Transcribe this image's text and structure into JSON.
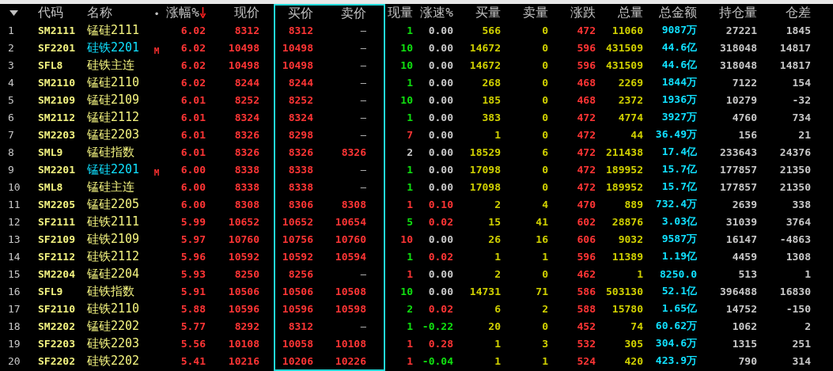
{
  "columns": [
    {
      "label": "代码"
    },
    {
      "label": "名称"
    },
    {
      "label": "•"
    },
    {
      "label": "涨幅%",
      "sorted": true
    },
    {
      "label": "现价"
    },
    {
      "label": "买价"
    },
    {
      "label": "卖价"
    },
    {
      "label": "现量"
    },
    {
      "label": "涨速%"
    },
    {
      "label": "买量"
    },
    {
      "label": "卖量"
    },
    {
      "label": "涨跌"
    },
    {
      "label": "总量"
    },
    {
      "label": "总金额"
    },
    {
      "label": "持仓量"
    },
    {
      "label": "仓差"
    }
  ],
  "rows": [
    {
      "num": "1",
      "code": "SM2111",
      "name": "锰硅2111",
      "main": false,
      "change_pct": "6.02",
      "price": "8312",
      "bid": "8312",
      "ask": "—",
      "ask_empty": true,
      "last_vol": {
        "text": "1",
        "color": "#10e010"
      },
      "speed": {
        "text": "0.00",
        "color": "#c8c8c8"
      },
      "bid_vol": "566",
      "ask_vol": "0",
      "change": "472",
      "volume": "11060",
      "amount": "9087万",
      "open_int": "27221",
      "oi_change": "1845"
    },
    {
      "num": "2",
      "code": "SF2201",
      "name": "硅铁2201",
      "main": true,
      "flag": "M",
      "change_pct": "6.02",
      "price": "10498",
      "bid": "10498",
      "ask": "—",
      "ask_empty": true,
      "last_vol": {
        "text": "10",
        "color": "#10e010"
      },
      "speed": {
        "text": "0.00",
        "color": "#c8c8c8"
      },
      "bid_vol": "14672",
      "ask_vol": "0",
      "change": "596",
      "volume": "431509",
      "amount": "44.6亿",
      "open_int": "318048",
      "oi_change": "14817"
    },
    {
      "num": "3",
      "code": "SFL8",
      "name": "硅铁主连",
      "main": false,
      "change_pct": "6.02",
      "price": "10498",
      "bid": "10498",
      "ask": "—",
      "ask_empty": true,
      "last_vol": {
        "text": "10",
        "color": "#10e010"
      },
      "speed": {
        "text": "0.00",
        "color": "#c8c8c8"
      },
      "bid_vol": "14672",
      "ask_vol": "0",
      "change": "596",
      "volume": "431509",
      "amount": "44.6亿",
      "open_int": "318048",
      "oi_change": "14817"
    },
    {
      "num": "4",
      "code": "SM2110",
      "name": "锰硅2110",
      "main": false,
      "change_pct": "6.02",
      "price": "8244",
      "bid": "8244",
      "ask": "—",
      "ask_empty": true,
      "last_vol": {
        "text": "1",
        "color": "#10e010"
      },
      "speed": {
        "text": "0.00",
        "color": "#c8c8c8"
      },
      "bid_vol": "268",
      "ask_vol": "0",
      "change": "468",
      "volume": "2269",
      "amount": "1844万",
      "open_int": "7122",
      "oi_change": "154"
    },
    {
      "num": "5",
      "code": "SM2109",
      "name": "锰硅2109",
      "main": false,
      "change_pct": "6.01",
      "price": "8252",
      "bid": "8252",
      "ask": "—",
      "ask_empty": true,
      "last_vol": {
        "text": "10",
        "color": "#10e010"
      },
      "speed": {
        "text": "0.00",
        "color": "#c8c8c8"
      },
      "bid_vol": "185",
      "ask_vol": "0",
      "change": "468",
      "volume": "2372",
      "amount": "1936万",
      "open_int": "10279",
      "oi_change": "-32"
    },
    {
      "num": "6",
      "code": "SM2112",
      "name": "锰硅2112",
      "main": false,
      "change_pct": "6.01",
      "price": "8324",
      "bid": "8324",
      "ask": "—",
      "ask_empty": true,
      "last_vol": {
        "text": "1",
        "color": "#10e010"
      },
      "speed": {
        "text": "0.00",
        "color": "#c8c8c8"
      },
      "bid_vol": "383",
      "ask_vol": "0",
      "change": "472",
      "volume": "4774",
      "amount": "3927万",
      "open_int": "4760",
      "oi_change": "734"
    },
    {
      "num": "7",
      "code": "SM2203",
      "name": "锰硅2203",
      "main": false,
      "change_pct": "6.01",
      "price": "8326",
      "bid": "8298",
      "ask": "—",
      "ask_empty": true,
      "last_vol": {
        "text": "7",
        "color": "#ff3535"
      },
      "speed": {
        "text": "0.00",
        "color": "#c8c8c8"
      },
      "bid_vol": "1",
      "ask_vol": "0",
      "change": "472",
      "volume": "44",
      "amount": "36.49万",
      "open_int": "156",
      "oi_change": "21"
    },
    {
      "num": "8",
      "code": "SML9",
      "name": "锰硅指数",
      "main": false,
      "change_pct": "6.01",
      "price": "8326",
      "bid": "8326",
      "ask": "8326",
      "ask_empty": false,
      "last_vol": {
        "text": "2",
        "color": "#c8c8c8"
      },
      "speed": {
        "text": "0.00",
        "color": "#c8c8c8"
      },
      "bid_vol": "18529",
      "ask_vol": "6",
      "change": "472",
      "volume": "211438",
      "amount": "17.4亿",
      "open_int": "233643",
      "oi_change": "24376"
    },
    {
      "num": "9",
      "code": "SM2201",
      "name": "锰硅2201",
      "main": true,
      "flag": "M",
      "change_pct": "6.00",
      "price": "8338",
      "bid": "8338",
      "ask": "—",
      "ask_empty": true,
      "last_vol": {
        "text": "1",
        "color": "#10e010"
      },
      "speed": {
        "text": "0.00",
        "color": "#c8c8c8"
      },
      "bid_vol": "17098",
      "ask_vol": "0",
      "change": "472",
      "volume": "189952",
      "amount": "15.7亿",
      "open_int": "177857",
      "oi_change": "21350"
    },
    {
      "num": "10",
      "code": "SML8",
      "name": "锰硅主连",
      "main": false,
      "change_pct": "6.00",
      "price": "8338",
      "bid": "8338",
      "ask": "—",
      "ask_empty": true,
      "last_vol": {
        "text": "1",
        "color": "#10e010"
      },
      "speed": {
        "text": "0.00",
        "color": "#c8c8c8"
      },
      "bid_vol": "17098",
      "ask_vol": "0",
      "change": "472",
      "volume": "189952",
      "amount": "15.7亿",
      "open_int": "177857",
      "oi_change": "21350"
    },
    {
      "num": "11",
      "code": "SM2205",
      "name": "锰硅2205",
      "main": false,
      "change_pct": "6.00",
      "price": "8308",
      "bid": "8306",
      "ask": "8308",
      "ask_empty": false,
      "last_vol": {
        "text": "1",
        "color": "#ff3535"
      },
      "speed": {
        "text": "0.10",
        "color": "#ff3535"
      },
      "bid_vol": "2",
      "ask_vol": "4",
      "change": "470",
      "volume": "889",
      "amount": "732.4万",
      "open_int": "2639",
      "oi_change": "338"
    },
    {
      "num": "12",
      "code": "SF2111",
      "name": "硅铁2111",
      "main": false,
      "change_pct": "5.99",
      "price": "10652",
      "bid": "10652",
      "ask": "10654",
      "ask_empty": false,
      "last_vol": {
        "text": "5",
        "color": "#10e010"
      },
      "speed": {
        "text": "0.02",
        "color": "#ff3535"
      },
      "bid_vol": "15",
      "ask_vol": "41",
      "change": "602",
      "volume": "28876",
      "amount": "3.03亿",
      "open_int": "31039",
      "oi_change": "3764"
    },
    {
      "num": "13",
      "code": "SF2109",
      "name": "硅铁2109",
      "main": false,
      "change_pct": "5.97",
      "price": "10760",
      "bid": "10756",
      "ask": "10760",
      "ask_empty": false,
      "last_vol": {
        "text": "10",
        "color": "#ff3535"
      },
      "speed": {
        "text": "0.00",
        "color": "#c8c8c8"
      },
      "bid_vol": "26",
      "ask_vol": "16",
      "change": "606",
      "volume": "9032",
      "amount": "9587万",
      "open_int": "16147",
      "oi_change": "-4863"
    },
    {
      "num": "14",
      "code": "SF2112",
      "name": "硅铁2112",
      "main": false,
      "change_pct": "5.96",
      "price": "10592",
      "bid": "10592",
      "ask": "10594",
      "ask_empty": false,
      "last_vol": {
        "text": "1",
        "color": "#10e010"
      },
      "speed": {
        "text": "0.02",
        "color": "#ff3535"
      },
      "bid_vol": "1",
      "ask_vol": "1",
      "change": "596",
      "volume": "11389",
      "amount": "1.19亿",
      "open_int": "4459",
      "oi_change": "1308"
    },
    {
      "num": "15",
      "code": "SM2204",
      "name": "锰硅2204",
      "main": false,
      "change_pct": "5.93",
      "price": "8250",
      "bid": "8256",
      "ask": "—",
      "ask_empty": true,
      "last_vol": {
        "text": "1",
        "color": "#ff3535"
      },
      "speed": {
        "text": "0.00",
        "color": "#c8c8c8"
      },
      "bid_vol": "2",
      "ask_vol": "0",
      "change": "462",
      "volume": "1",
      "amount": "8250.0",
      "open_int": "513",
      "oi_change": "1"
    },
    {
      "num": "16",
      "code": "SFL9",
      "name": "硅铁指数",
      "main": false,
      "change_pct": "5.91",
      "price": "10506",
      "bid": "10506",
      "ask": "10508",
      "ask_empty": false,
      "last_vol": {
        "text": "10",
        "color": "#10e010"
      },
      "speed": {
        "text": "0.00",
        "color": "#c8c8c8"
      },
      "bid_vol": "14731",
      "ask_vol": "71",
      "change": "586",
      "volume": "503130",
      "amount": "52.1亿",
      "open_int": "396488",
      "oi_change": "16830"
    },
    {
      "num": "17",
      "code": "SF2110",
      "name": "硅铁2110",
      "main": false,
      "change_pct": "5.88",
      "price": "10596",
      "bid": "10596",
      "ask": "10598",
      "ask_empty": false,
      "last_vol": {
        "text": "2",
        "color": "#10e010"
      },
      "speed": {
        "text": "0.02",
        "color": "#ff3535"
      },
      "bid_vol": "6",
      "ask_vol": "2",
      "change": "588",
      "volume": "15780",
      "amount": "1.65亿",
      "open_int": "14752",
      "oi_change": "-150"
    },
    {
      "num": "18",
      "code": "SM2202",
      "name": "锰硅2202",
      "main": false,
      "change_pct": "5.77",
      "price": "8292",
      "bid": "8312",
      "ask": "—",
      "ask_empty": true,
      "last_vol": {
        "text": "1",
        "color": "#10e010"
      },
      "speed": {
        "text": "-0.22",
        "color": "#10e010"
      },
      "bid_vol": "20",
      "ask_vol": "0",
      "change": "452",
      "volume": "74",
      "amount": "60.62万",
      "open_int": "1062",
      "oi_change": "2"
    },
    {
      "num": "19",
      "code": "SF2203",
      "name": "硅铁2203",
      "main": false,
      "change_pct": "5.56",
      "price": "10108",
      "bid": "10058",
      "ask": "10108",
      "ask_empty": false,
      "last_vol": {
        "text": "1",
        "color": "#ff3535"
      },
      "speed": {
        "text": "0.28",
        "color": "#ff3535"
      },
      "bid_vol": "1",
      "ask_vol": "3",
      "change": "532",
      "volume": "305",
      "amount": "304.6万",
      "open_int": "1315",
      "oi_change": "251"
    },
    {
      "num": "20",
      "code": "SF2202",
      "name": "硅铁2202",
      "main": false,
      "change_pct": "5.41",
      "price": "10216",
      "bid": "10206",
      "ask": "10226",
      "ask_empty": false,
      "last_vol": {
        "text": "1",
        "color": "#ff3535"
      },
      "speed": {
        "text": "-0.04",
        "color": "#10e010"
      },
      "bid_vol": "1",
      "ask_vol": "1",
      "change": "524",
      "volume": "420",
      "amount": "423.9万",
      "open_int": "790",
      "oi_change": "314"
    }
  ]
}
